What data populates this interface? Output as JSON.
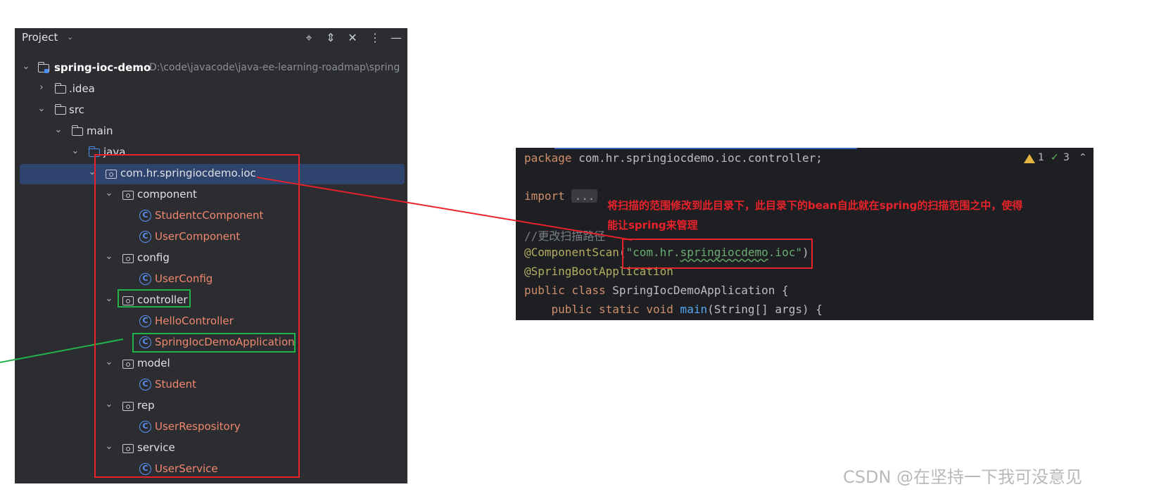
{
  "panel": {
    "title": "Project",
    "header_icons": [
      "locate-icon",
      "expand-all-icon",
      "collapse-all-icon",
      "more-options-icon",
      "minimize-icon"
    ]
  },
  "tree": {
    "root_label": "spring-ioc-demo",
    "root_path": "D:\\code\\javacode\\java-ee-learning-roadmap\\spring",
    "idea": ".idea",
    "src": "src",
    "main": "main",
    "java": "java",
    "package_root": "com.hr.springiocdemo.ioc",
    "component": "component",
    "studentc_component": "StudentcComponent",
    "user_component": "UserComponent",
    "config": "config",
    "user_config": "UserConfig",
    "controller": "controller",
    "hello_controller": "HelloController",
    "app_class": "SpringIocDemoApplication",
    "model": "model",
    "student": "Student",
    "rep": "rep",
    "user_respository": "UserRespository",
    "service": "service",
    "user_service": "UserService"
  },
  "editor": {
    "kw_package": "package",
    "package_name": " com.hr.springiocdemo.ioc.controller;",
    "kw_import": "import",
    "import_fold": "...",
    "comment": "//更改扫描路径",
    "ann_componentscan": "@ComponentScan",
    "paren_open": "(",
    "str_q1": "\"com.hr.",
    "str_mid": "springiocdemo",
    "str_q2": ".ioc\"",
    "paren_close": ")",
    "ann_springboot": "@SpringBootApplication",
    "kw_public_class": "public class",
    "class_decl": " SpringIocDemoApplication {",
    "kw_public_static_void": "    public static void",
    "fn_main": " main",
    "main_args": "(String[] args) {",
    "warning_count": "1",
    "check_count": "3"
  },
  "annotation": {
    "line1": "将扫描的范围修改到此目录下，此目录下的bean自此就在spring的扫描范围之中，使得",
    "line2": "能让spring来管理"
  },
  "watermark": "CSDN @在坚持一下我可没意见",
  "colors": {
    "annotation_red": "#e8222a",
    "annotation_green": "#22b24c",
    "class_name": "#f08770",
    "selection": "#2e436e"
  }
}
